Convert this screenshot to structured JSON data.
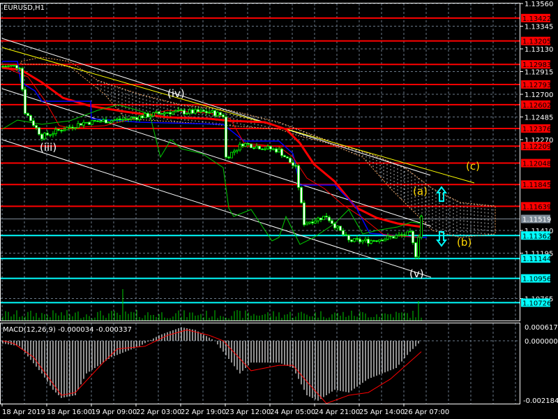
{
  "header": {
    "symbol_label": "EURUSD,H1"
  },
  "macd": {
    "label": "MACD(12,26,9) -0.000034 -0.000337",
    "axis_top": "0.000617",
    "axis_zero": "0.000000",
    "axis_bottom": "-0.002184"
  },
  "price_axis": [
    "1.13560",
    "1.13345",
    "1.13130",
    "1.12915",
    "1.12700",
    "1.12485",
    "1.12270",
    "1.11410",
    "1.11195",
    "1.10765"
  ],
  "levels": [
    {
      "price": 1.13422,
      "label": "1.13422",
      "color": "#ff0000"
    },
    {
      "price": 1.13205,
      "label": "1.13205",
      "color": "#ff0000"
    },
    {
      "price": 1.12983,
      "label": "1.12983",
      "color": "#ff0000"
    },
    {
      "price": 1.12793,
      "label": "1.12793",
      "color": "#ff0000"
    },
    {
      "price": 1.12602,
      "label": "1.12602",
      "color": "#ff0000"
    },
    {
      "price": 1.12376,
      "label": "1.12376",
      "color": "#ff0000"
    },
    {
      "price": 1.12209,
      "label": "1.12209",
      "color": "#ff0000"
    },
    {
      "price": 1.12048,
      "label": "1.12048",
      "color": "#ff0000"
    },
    {
      "price": 1.11845,
      "label": "1.11845",
      "color": "#ff0000"
    },
    {
      "price": 1.11639,
      "label": "1.11639",
      "color": "#ff0000"
    },
    {
      "price": 1.11519,
      "label": "1.11519",
      "color": "#7f8c99"
    },
    {
      "price": 1.11362,
      "label": "1.11362",
      "color": "#00ffff"
    },
    {
      "price": 1.11144,
      "label": "1.11144",
      "color": "#00ffff"
    },
    {
      "price": 1.10956,
      "label": "1.10956",
      "color": "#00ffff"
    },
    {
      "price": 1.10726,
      "label": "1.10726",
      "color": "#00ffff"
    }
  ],
  "time_axis": [
    "18 Apr 2019",
    "18 Apr 16:00",
    "19 Apr 09:00",
    "22 Apr 03:00",
    "22 Apr 19:00",
    "23 Apr 12:00",
    "24 Apr 05:00",
    "24 Apr 21:00",
    "25 Apr 14:00",
    "26 Apr 07:00"
  ],
  "waves": [
    {
      "text": "(iii)",
      "color": "#ffffff"
    },
    {
      "text": "(iv)",
      "color": "#ffffff"
    },
    {
      "text": "(v)",
      "color": "#ffffff"
    },
    {
      "text": "(a)",
      "color": "#ffd700"
    },
    {
      "text": "(b)",
      "color": "#ffd700"
    },
    {
      "text": "(c)",
      "color": "#ffd700"
    }
  ],
  "chart_data": {
    "type": "candlestick",
    "symbol": "EURUSD",
    "timeframe": "H1",
    "price_range": [
      1.10765,
      1.1356
    ],
    "close_keypoints": [
      [
        1,
        1.12965
      ],
      [
        7,
        1.12965
      ],
      [
        9,
        1.12535
      ],
      [
        15,
        1.123
      ],
      [
        22,
        1.12366
      ],
      [
        30,
        1.12432
      ],
      [
        45,
        1.12465
      ],
      [
        60,
        1.12532
      ],
      [
        75,
        1.12532
      ],
      [
        80,
        1.12499
      ],
      [
        81,
        1.121
      ],
      [
        87,
        1.12233
      ],
      [
        100,
        1.12167
      ],
      [
        106,
        1.12001
      ],
      [
        109,
        1.1148
      ],
      [
        117,
        1.11546
      ],
      [
        125,
        1.11311
      ],
      [
        132,
        1.11311
      ],
      [
        140,
        1.11345
      ],
      [
        147,
        1.11378
      ],
      [
        149,
        1.1118
      ],
      [
        151,
        1.11546
      ]
    ],
    "macd_keypoints": [
      [
        1,
        -0.0001
      ],
      [
        7,
        -0.0002
      ],
      [
        15,
        -0.0012
      ],
      [
        19,
        -0.0018
      ],
      [
        22,
        -0.0021
      ],
      [
        27,
        -0.002
      ],
      [
        31,
        -0.0012
      ],
      [
        40,
        -0.0006
      ],
      [
        50,
        -0.0002
      ],
      [
        57,
        0.0002
      ],
      [
        65,
        0.0005
      ],
      [
        70,
        0.0004
      ],
      [
        77,
        0.0
      ],
      [
        80,
        -0.0004
      ],
      [
        86,
        -0.0012
      ],
      [
        90,
        -0.0008
      ],
      [
        100,
        -0.0008
      ],
      [
        105,
        -0.001
      ],
      [
        110,
        -0.002
      ],
      [
        114,
        -0.0022
      ],
      [
        120,
        -0.0018
      ],
      [
        125,
        -0.0019
      ],
      [
        132,
        -0.0014
      ],
      [
        142,
        -0.001
      ],
      [
        147,
        -0.0004
      ],
      [
        151,
        0.0
      ]
    ],
    "signal_keypoints": [
      [
        1,
        0.0
      ],
      [
        5,
        -0.0001
      ],
      [
        12,
        -0.0006
      ],
      [
        22,
        -0.002
      ],
      [
        27,
        -0.0019
      ],
      [
        37,
        -0.0008
      ],
      [
        42,
        -0.0003
      ],
      [
        52,
        -0.0002
      ],
      [
        60,
        0.0002
      ],
      [
        67,
        0.0004
      ],
      [
        75,
        0.0002
      ],
      [
        80,
        0.0
      ],
      [
        90,
        -0.0011
      ],
      [
        100,
        -0.0009
      ],
      [
        105,
        -0.0009
      ],
      [
        110,
        -0.0015
      ],
      [
        117,
        -0.0023
      ],
      [
        125,
        -0.002
      ],
      [
        132,
        -0.0019
      ],
      [
        140,
        -0.0014
      ],
      [
        151,
        -0.0004
      ]
    ]
  }
}
